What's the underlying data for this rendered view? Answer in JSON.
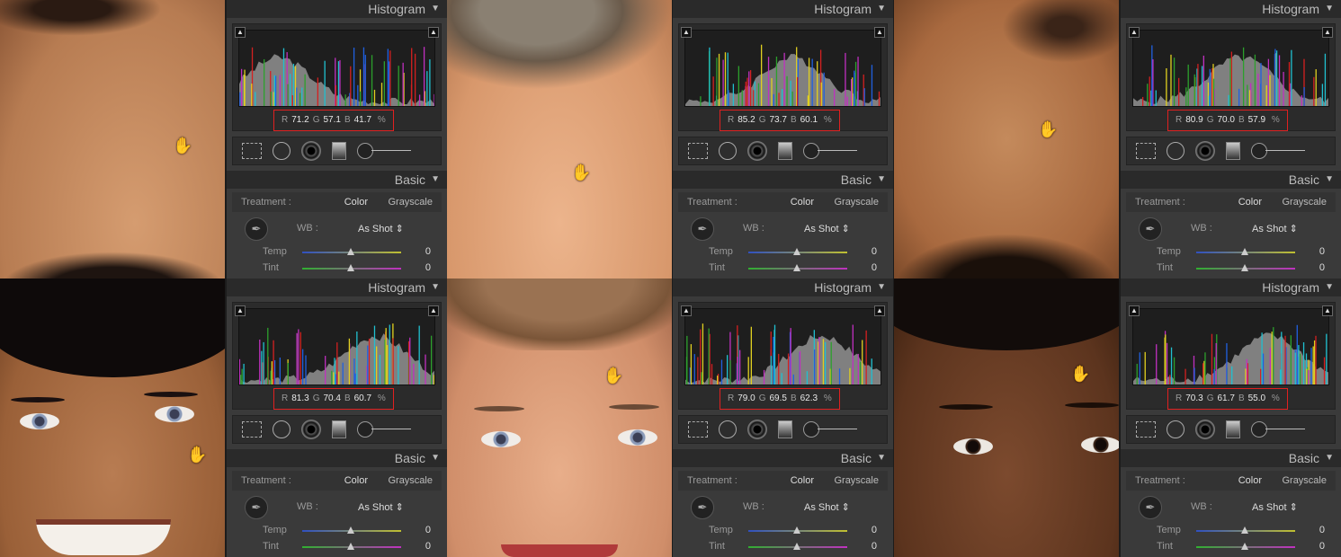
{
  "panels": [
    {
      "histogram_title": "Histogram",
      "r_label": "R",
      "r": "71.2",
      "g_label": "G",
      "g": "57.1",
      "b_label": "B",
      "b": "41.7",
      "pct": "%",
      "basic_title": "Basic",
      "treatment_label": "Treatment :",
      "treatment_color": "Color",
      "treatment_gray": "Grayscale",
      "wb_label": "WB :",
      "wb_value": "As Shot",
      "temp_label": "Temp",
      "temp_value": "0",
      "tint_label": "Tint",
      "tint_value": "0"
    },
    {
      "histogram_title": "Histogram",
      "r_label": "R",
      "r": "85.2",
      "g_label": "G",
      "g": "73.7",
      "b_label": "B",
      "b": "60.1",
      "pct": "%",
      "basic_title": "Basic",
      "treatment_label": "Treatment :",
      "treatment_color": "Color",
      "treatment_gray": "Grayscale",
      "wb_label": "WB :",
      "wb_value": "As Shot",
      "temp_label": "Temp",
      "temp_value": "0",
      "tint_label": "Tint",
      "tint_value": "0"
    },
    {
      "histogram_title": "Histogram",
      "r_label": "R",
      "r": "80.9",
      "g_label": "G",
      "g": "70.0",
      "b_label": "B",
      "b": "57.9",
      "pct": "%",
      "basic_title": "Basic",
      "treatment_label": "Treatment :",
      "treatment_color": "Color",
      "treatment_gray": "Grayscale",
      "wb_label": "WB :",
      "wb_value": "As Shot",
      "temp_label": "Temp",
      "temp_value": "0",
      "tint_label": "Tint",
      "tint_value": "0"
    },
    {
      "histogram_title": "Histogram",
      "r_label": "R",
      "r": "81.3",
      "g_label": "G",
      "g": "70.4",
      "b_label": "B",
      "b": "60.7",
      "pct": "%",
      "basic_title": "Basic",
      "treatment_label": "Treatment :",
      "treatment_color": "Color",
      "treatment_gray": "Grayscale",
      "wb_label": "WB :",
      "wb_value": "As Shot",
      "temp_label": "Temp",
      "temp_value": "0",
      "tint_label": "Tint",
      "tint_value": "0"
    },
    {
      "histogram_title": "Histogram",
      "r_label": "R",
      "r": "79.0",
      "g_label": "G",
      "g": "69.5",
      "b_label": "B",
      "b": "62.3",
      "pct": "%",
      "basic_title": "Basic",
      "treatment_label": "Treatment :",
      "treatment_color": "Color",
      "treatment_gray": "Grayscale",
      "wb_label": "WB :",
      "wb_value": "As Shot",
      "temp_label": "Temp",
      "temp_value": "0",
      "tint_label": "Tint",
      "tint_value": "0"
    },
    {
      "histogram_title": "Histogram",
      "r_label": "R",
      "r": "70.3",
      "g_label": "G",
      "g": "61.7",
      "b_label": "B",
      "b": "55.0",
      "pct": "%",
      "basic_title": "Basic",
      "treatment_label": "Treatment :",
      "treatment_color": "Color",
      "treatment_gray": "Grayscale",
      "wb_label": "WB :",
      "wb_value": "As Shot",
      "temp_label": "Temp",
      "temp_value": "0",
      "tint_label": "Tint",
      "tint_value": "0"
    }
  ],
  "icons": {
    "collapse": "triangle-down",
    "hand": "hand-cursor",
    "clip": "clipping-triangle",
    "eyedropper": "eyedropper",
    "stepper": "up-down-stepper"
  },
  "colors": {
    "highlight_box": "#e02020",
    "panel_bg": "#3a3a3a",
    "header_bg": "#2a2a2a",
    "hist_red": "#d42020",
    "hist_green": "#2ca02c",
    "hist_blue": "#2060e0",
    "hist_yellow": "#e0d020",
    "hist_cyan": "#20c0d0",
    "hist_magenta": "#c030c0",
    "hist_gray": "#999999"
  },
  "photos": [
    {
      "subject": "forehead-closeup",
      "tone": "#c78e64"
    },
    {
      "subject": "forehead-closeup",
      "tone": "#e0a57c"
    },
    {
      "subject": "forehead-closeup",
      "tone": "#b0744a"
    },
    {
      "subject": "face-smiling",
      "tone": "#a8704a"
    },
    {
      "subject": "face-smiling",
      "tone": "#d89a78"
    },
    {
      "subject": "face-eyes",
      "tone": "#6a3e26"
    }
  ]
}
